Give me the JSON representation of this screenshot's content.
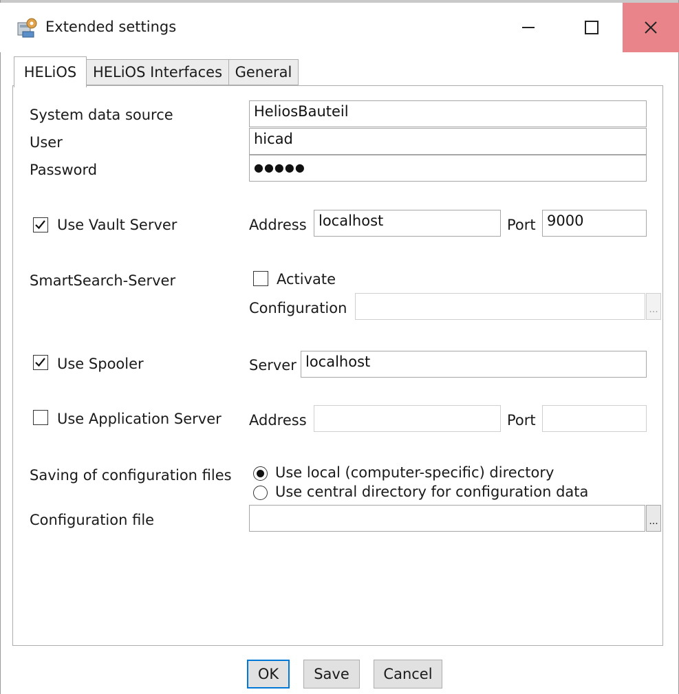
{
  "window": {
    "title": "Extended settings",
    "icon": "app-settings-icon"
  },
  "title_buttons": {
    "minimize": "minimize-icon",
    "maximize": "maximize-icon",
    "close": "close-icon",
    "close_color": "#e8848a"
  },
  "tabs": [
    {
      "label": "HELiOS"
    },
    {
      "label": "HELiOS Interfaces"
    },
    {
      "label": "General"
    }
  ],
  "helios": {
    "system_data_source": {
      "label": "System data source",
      "value": "HeliosBauteil"
    },
    "user": {
      "label": "User",
      "value": "hicad"
    },
    "password": {
      "label": "Password",
      "value": "●●●●●"
    },
    "vault": {
      "label": "Use Vault Server",
      "checked": true,
      "address_label": "Address",
      "address": "localhost",
      "port_label": "Port",
      "port": "9000"
    },
    "smartsearch": {
      "label": "SmartSearch-Server",
      "activate_label": "Activate",
      "activate_checked": false,
      "configuration_label": "Configuration",
      "configuration": "",
      "browse": "..."
    },
    "spooler": {
      "label": "Use Spooler",
      "checked": true,
      "server_label": "Server",
      "server": "localhost"
    },
    "app_server": {
      "label": "Use Application Server",
      "checked": false,
      "address_label": "Address",
      "address": "",
      "port_label": "Port",
      "port": ""
    },
    "config_saving": {
      "label": "Saving of configuration files",
      "options": [
        {
          "label": "Use local (computer-specific) directory",
          "selected": true
        },
        {
          "label": "Use central directory for configuration data",
          "selected": false
        }
      ]
    },
    "config_file": {
      "label": "Configuration file",
      "value": "",
      "browse": "..."
    }
  },
  "buttons": {
    "ok": "OK",
    "save": "Save",
    "cancel": "Cancel"
  },
  "colors": {
    "accent": "#0078d7",
    "check": "#111111"
  }
}
